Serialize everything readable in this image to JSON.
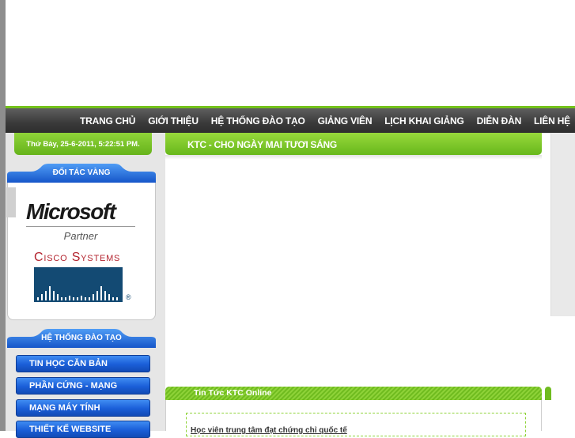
{
  "nav": {
    "items": [
      "TRANG CHỦ",
      "GIỚI THIỆU",
      "HỆ THỐNG ĐÀO TẠO",
      "GIẢNG VIÊN",
      "LỊCH KHAI GIẢNG",
      "DIỄN ĐÀN",
      "LIÊN HỆ"
    ]
  },
  "left": {
    "date": "Thứ Bảy, 25-6-2011, 5:22:51 PM.",
    "partners_title": "ĐỐI TÁC VÀNG",
    "microsoft_logo": "Microsoft",
    "microsoft_partner": "Partner",
    "cisco_logo": "Cisco Systems",
    "cisco_reg": "®",
    "training_title": "HỆ THỐNG ĐÀO TẠO",
    "training_items": [
      "TIN HỌC CĂN BẢN",
      "PHẦN CỨNG - MẠNG",
      "MẠNG MÁY TÍNH",
      "THIẾT KẾ WEBSITE"
    ]
  },
  "main": {
    "title": "KTC - CHO NGÀY MAI TƯƠI SÁNG",
    "news_title": "Tin Tức KTC Online",
    "news_first": "Học viên trung tâm đạt chứng chỉ quốc tế"
  },
  "colors": {
    "accent_green": "#74c21b",
    "nav_dark": "#3a3a3a",
    "menu_blue": "#1a5ed8"
  }
}
